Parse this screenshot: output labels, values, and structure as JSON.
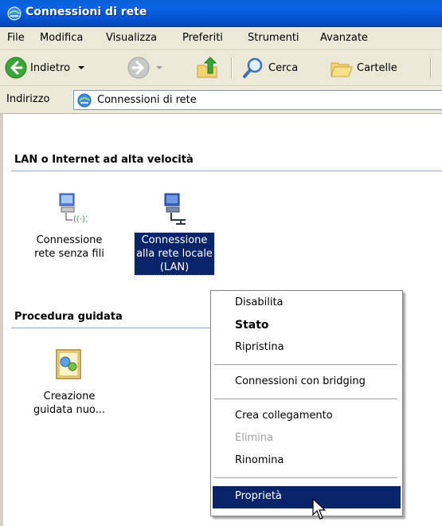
{
  "window": {
    "title": "Connessioni di rete"
  },
  "menubar": {
    "items": [
      "File",
      "Modifica",
      "Visualizza",
      "Preferiti",
      "Strumenti",
      "Avanzate"
    ]
  },
  "toolbar": {
    "back_label": "Indietro",
    "search_label": "Cerca",
    "folders_label": "Cartelle"
  },
  "address": {
    "label": "Indirizzo",
    "value": "Connessioni di rete"
  },
  "groups": [
    {
      "header": "LAN o Internet ad alta velocità",
      "items": [
        {
          "label_line1": "Connessione",
          "label_line2": "rete senza fili",
          "label_line3": "",
          "icon": "wireless-network-icon",
          "selected": false
        },
        {
          "label_line1": "Connessione",
          "label_line2": "alla rete locale",
          "label_line3": "(LAN)",
          "icon": "lan-network-icon",
          "selected": true
        }
      ]
    },
    {
      "header": "Procedura guidata",
      "items": [
        {
          "label_line1": "Creazione",
          "label_line2": "guidata nuo...",
          "label_line3": "",
          "icon": "wizard-icon",
          "selected": false
        }
      ]
    }
  ],
  "context_menu": {
    "items": [
      {
        "label": "Disabilita",
        "style": "normal"
      },
      {
        "label": "Stato",
        "style": "bold"
      },
      {
        "label": "Ripristina",
        "style": "normal"
      },
      {
        "label": "Connessioni con bridging",
        "style": "normal"
      },
      {
        "label": "Crea collegamento",
        "style": "normal"
      },
      {
        "label": "Elimina",
        "style": "disabled"
      },
      {
        "label": "Rinomina",
        "style": "normal"
      },
      {
        "label": "Proprietà",
        "style": "highlighted"
      }
    ]
  },
  "colors": {
    "titlebar": "#0a5fd6",
    "selection": "#0a246a",
    "chrome": "#ece9d8"
  }
}
